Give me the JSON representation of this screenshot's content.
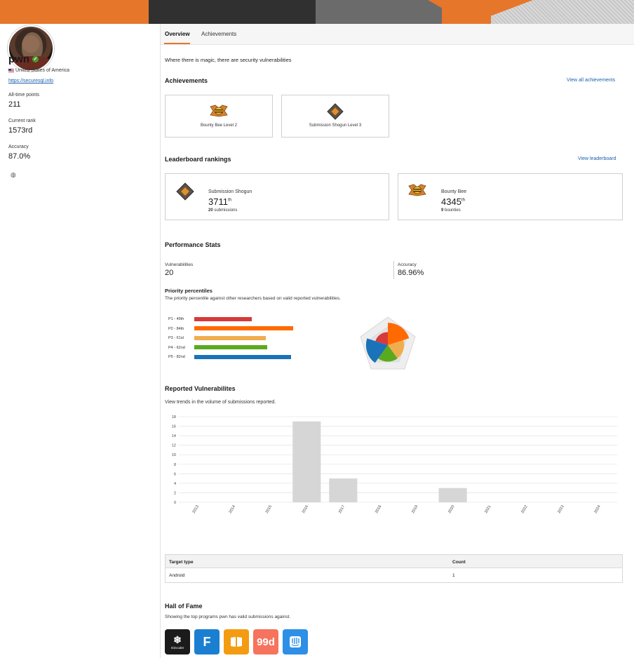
{
  "profile": {
    "username": "pwn",
    "country": "United States of America",
    "website": "https://securesql.info",
    "stats": [
      {
        "label": "All-time points",
        "value": "211"
      },
      {
        "label": "Current rank",
        "value": "1573rd"
      },
      {
        "label": "Accuracy",
        "value": "87.0%"
      }
    ]
  },
  "tabs": [
    {
      "label": "Overview",
      "active": true
    },
    {
      "label": "Achievements",
      "active": false
    }
  ],
  "tagline": "Where there is magic, there are security vulnerabilities",
  "achievements": {
    "title": "Achievements",
    "view_all": "View all achievements",
    "items": [
      {
        "label": "Bounty Bee Level 2",
        "icon": "bee-badge-icon"
      },
      {
        "label": "Submission Shogun Level 3",
        "icon": "shogun-badge-icon"
      }
    ]
  },
  "leaderboard": {
    "title": "Leaderboard rankings",
    "view_all": "View leaderboard",
    "items": [
      {
        "name": "Submission Shogun",
        "rank": "3711",
        "suffix": "th",
        "count": "20",
        "unit": "submissions",
        "icon": "shogun-badge-icon"
      },
      {
        "name": "Bounty Bee",
        "rank": "4345",
        "suffix": "th",
        "count": "9",
        "unit": "bounties",
        "icon": "bee-badge-icon"
      }
    ]
  },
  "performance": {
    "title": "Performance Stats",
    "vulnerabilities_label": "Vulnerabilities",
    "vulnerabilities_value": "20",
    "accuracy_label": "Accuracy",
    "accuracy_value": "86.96%"
  },
  "priority": {
    "title": "Priority percentiles",
    "subtitle": "The priority percentile against other researchers based on valid reported vulnerabilities.",
    "bars": [
      {
        "label": "P1 - 49th",
        "value": 49,
        "color": "#d63a3a"
      },
      {
        "label": "P2 - 84th",
        "value": 84,
        "color": "#ff6a00"
      },
      {
        "label": "P3 - 61st",
        "value": 61,
        "color": "#f0ad4e"
      },
      {
        "label": "P4 - 62nd",
        "value": 62,
        "color": "#5aaa1e"
      },
      {
        "label": "P5 - 82nd",
        "value": 82,
        "color": "#1a73b8"
      }
    ]
  },
  "reported": {
    "title": "Reported Vulnerabilites",
    "subtitle": "View trends in the volume of submissions reported."
  },
  "chart_data": {
    "type": "bar",
    "categories": [
      "2013",
      "2014",
      "2015",
      "2016",
      "2017",
      "2018",
      "2019",
      "2020",
      "2021",
      "2022",
      "2023",
      "2024"
    ],
    "values": [
      0,
      0,
      0,
      17,
      5,
      0,
      0,
      3,
      0,
      0,
      0,
      0
    ],
    "yticks": [
      0,
      2,
      4,
      6,
      8,
      10,
      12,
      14,
      16,
      18
    ],
    "ylim": [
      0,
      18
    ],
    "bar_color": "#d6d6d6",
    "grid": true
  },
  "target_table": {
    "headers": [
      "Target type",
      "Count"
    ],
    "rows": [
      [
        "Android",
        "1"
      ]
    ]
  },
  "hall_of_fame": {
    "title": "Hall of Fame",
    "subtitle": "Showing the top programs pwn has valid submissions against.",
    "logos": [
      {
        "name": "ICEcoder",
        "text": "ICEcoder",
        "color": "#1b1b1b"
      },
      {
        "name": "FanDuel",
        "text": "F",
        "color": "#1a7fd1"
      },
      {
        "name": "book",
        "text": "",
        "color": "#f39c12"
      },
      {
        "name": "99designs",
        "text": "99d",
        "color": "#f6735e"
      },
      {
        "name": "Intercom",
        "text": "",
        "color": "#2d8fe6"
      }
    ]
  }
}
